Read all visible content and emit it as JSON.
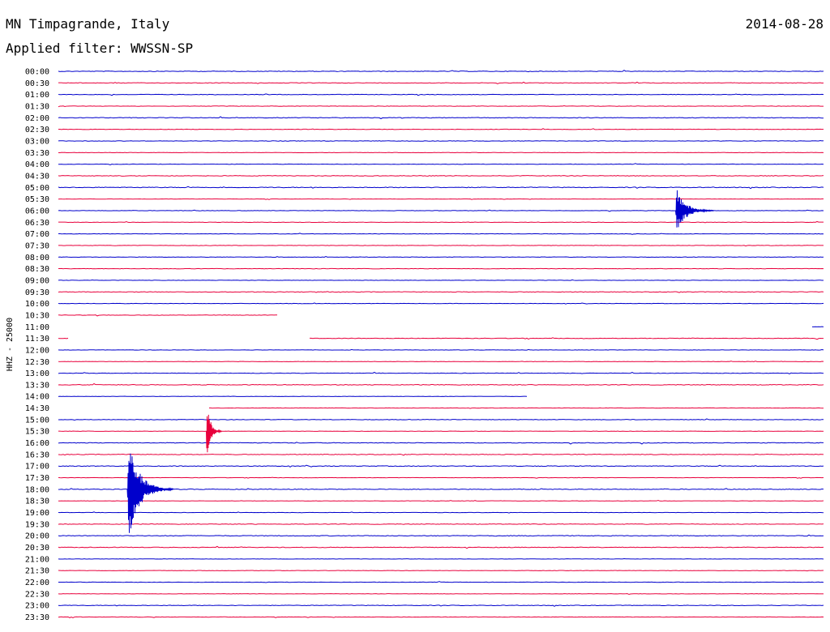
{
  "header": {
    "station": "MN Timpagrande, Italy",
    "date": "2014-08-28",
    "filter": "Applied filter: WWSSN-SP"
  },
  "colors": {
    "even_hour": "#0000cc",
    "half_hour": "#e8003c"
  },
  "chart_data": {
    "type": "line",
    "title": "MN Timpagrande, Italy",
    "subtitle": "Applied filter: WWSSN-SP",
    "ylabel": "HHZ - 25000",
    "categories": [
      "00:00",
      "00:30",
      "01:00",
      "01:30",
      "02:00",
      "02:30",
      "03:00",
      "03:30",
      "04:00",
      "04:30",
      "05:00",
      "05:30",
      "06:00",
      "06:30",
      "07:00",
      "07:30",
      "08:00",
      "08:30",
      "09:00",
      "09:30",
      "10:00",
      "10:30",
      "11:00",
      "11:30",
      "12:00",
      "12:30",
      "13:00",
      "13:30",
      "14:00",
      "14:30",
      "15:00",
      "15:30",
      "16:00",
      "16:30",
      "17:00",
      "17:30",
      "18:00",
      "18:30",
      "19:00",
      "19:30",
      "20:00",
      "20:30",
      "21:00",
      "21:30",
      "22:00",
      "22:30",
      "23:00",
      "23:30"
    ],
    "trace_minutes": 30,
    "gaps": [
      {
        "line": "10:30",
        "start_min": 8.6,
        "end_min": 30
      },
      {
        "line": "11:00",
        "start_min": 0,
        "end_min": 29.5
      },
      {
        "line": "11:30",
        "start_min": 0.4,
        "end_min": 9.8
      },
      {
        "line": "14:00",
        "start_min": 18.4,
        "end_min": 30
      },
      {
        "line": "14:30",
        "start_min": 0,
        "end_min": 5.9
      }
    ],
    "events": [
      {
        "line": "06:00",
        "minute": 24.2,
        "amplitude_lines": 1.0,
        "duration_min": 1.5
      },
      {
        "line": "15:30",
        "minute": 5.8,
        "amplitude_lines": 1.4,
        "duration_min": 0.6
      },
      {
        "line": "18:00",
        "minute": 2.7,
        "amplitude_lines": 2.2,
        "duration_min": 1.8
      }
    ]
  }
}
